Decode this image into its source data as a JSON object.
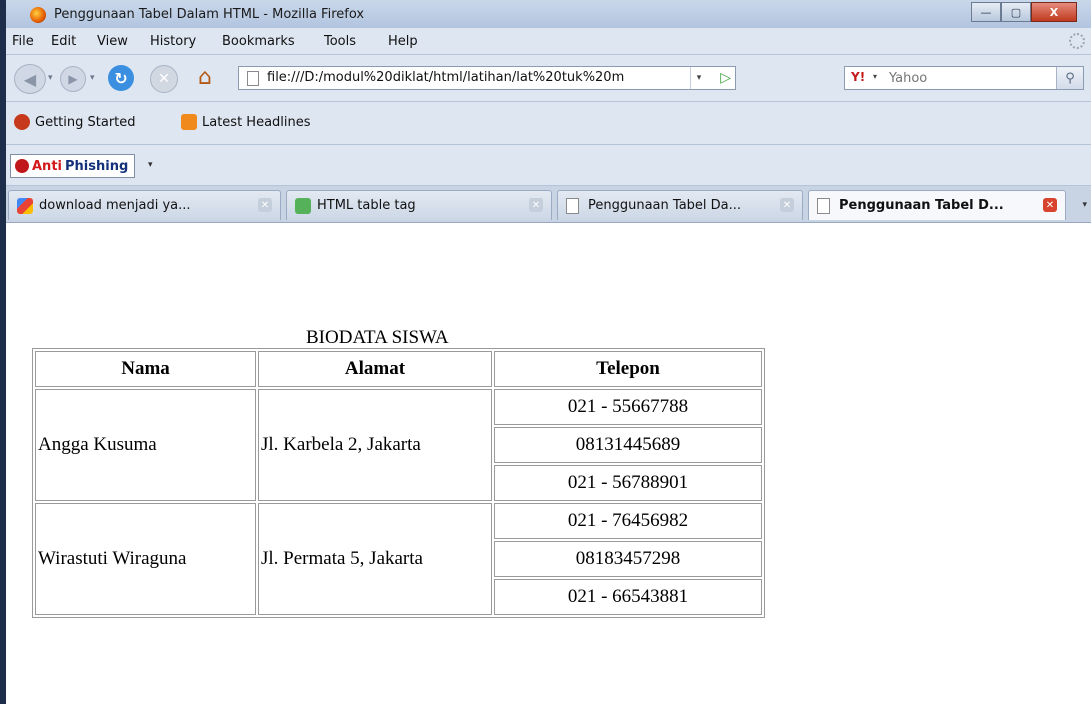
{
  "window": {
    "title": "Penggunaan Tabel Dalam HTML - Mozilla Firefox",
    "controls": {
      "minimize": "—",
      "maximize": "▢",
      "close": "X"
    }
  },
  "menu": [
    "File",
    "Edit",
    "View",
    "History",
    "Bookmarks",
    "Tools",
    "Help"
  ],
  "nav": {
    "url": "file:///D:/modul%20diklat/html/latihan/lat%20tuk%20m",
    "search_placeholder": "Yahoo",
    "search_engine": "Y!"
  },
  "bookmarks": [
    "Getting Started",
    "Latest Headlines"
  ],
  "antiphishing": {
    "part1": "Anti",
    "part2": "Phishing"
  },
  "tabs": [
    {
      "label": "download menjadi ya...",
      "icon": "google-icon",
      "active": false
    },
    {
      "label": "HTML table tag",
      "icon": "w3schools-icon",
      "active": false
    },
    {
      "label": "Penggunaan Tabel Da...",
      "icon": "page-icon",
      "active": false
    },
    {
      "label": "Penggunaan Tabel D...",
      "icon": "page-icon",
      "active": true
    }
  ],
  "page": {
    "caption": "BIODATA SISWA",
    "headers": [
      "Nama",
      "Alamat",
      "Telepon"
    ],
    "rows": [
      {
        "nama": "Angga Kusuma",
        "alamat": "Jl. Karbela 2, Jakarta",
        "telepon": [
          "021 - 55667788",
          "08131445689",
          "021 - 56788901"
        ]
      },
      {
        "nama": "Wirastuti Wiraguna",
        "alamat": "Jl. Permata  5, Jakarta",
        "telepon": [
          "021 - 76456982",
          "08183457298",
          "021 - 66543881"
        ]
      }
    ]
  },
  "colors": {
    "accent": "#dde6f1",
    "close_button": "#c03a1e"
  }
}
